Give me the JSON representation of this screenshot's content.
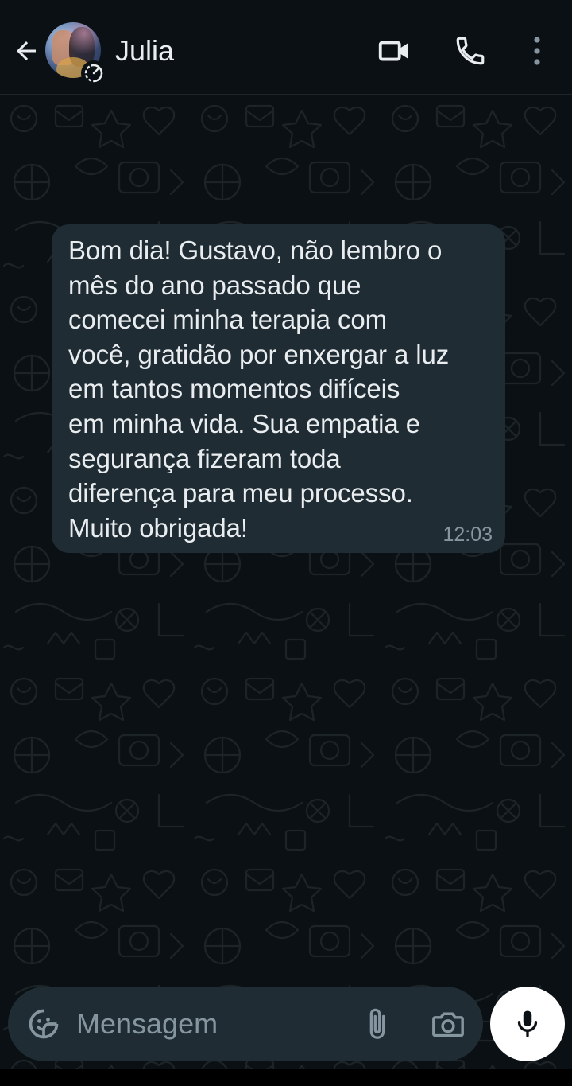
{
  "header": {
    "contact_name": "Julia",
    "back_icon": "arrow-left-icon",
    "video_icon": "video-camera-icon",
    "call_icon": "phone-icon",
    "menu_icon": "more-vertical-icon",
    "avatar_badge_icon": "disappearing-timer-icon"
  },
  "message": {
    "text": "Bom dia! Gustavo, não lembro o\nmês do ano passado que\ncomecei minha terapia com\nvocê, gratidão por enxergar a luz\nem tantos momentos difíceis\nem minha vida. Sua empatia e\nsegurança fizeram toda\ndiferença para meu processo.\nMuito obrigada!",
    "time": "12:03",
    "direction": "incoming"
  },
  "composer": {
    "placeholder": "Mensagem",
    "value": "",
    "emoji_icon": "sticker-emoji-icon",
    "attach_icon": "paperclip-icon",
    "camera_icon": "camera-icon",
    "mic_icon": "microphone-icon"
  },
  "colors": {
    "background": "#0b1014",
    "bubble": "#1f2c33",
    "text": "#e9edef",
    "muted": "#8696a0",
    "mic_button": "#ffffff"
  }
}
